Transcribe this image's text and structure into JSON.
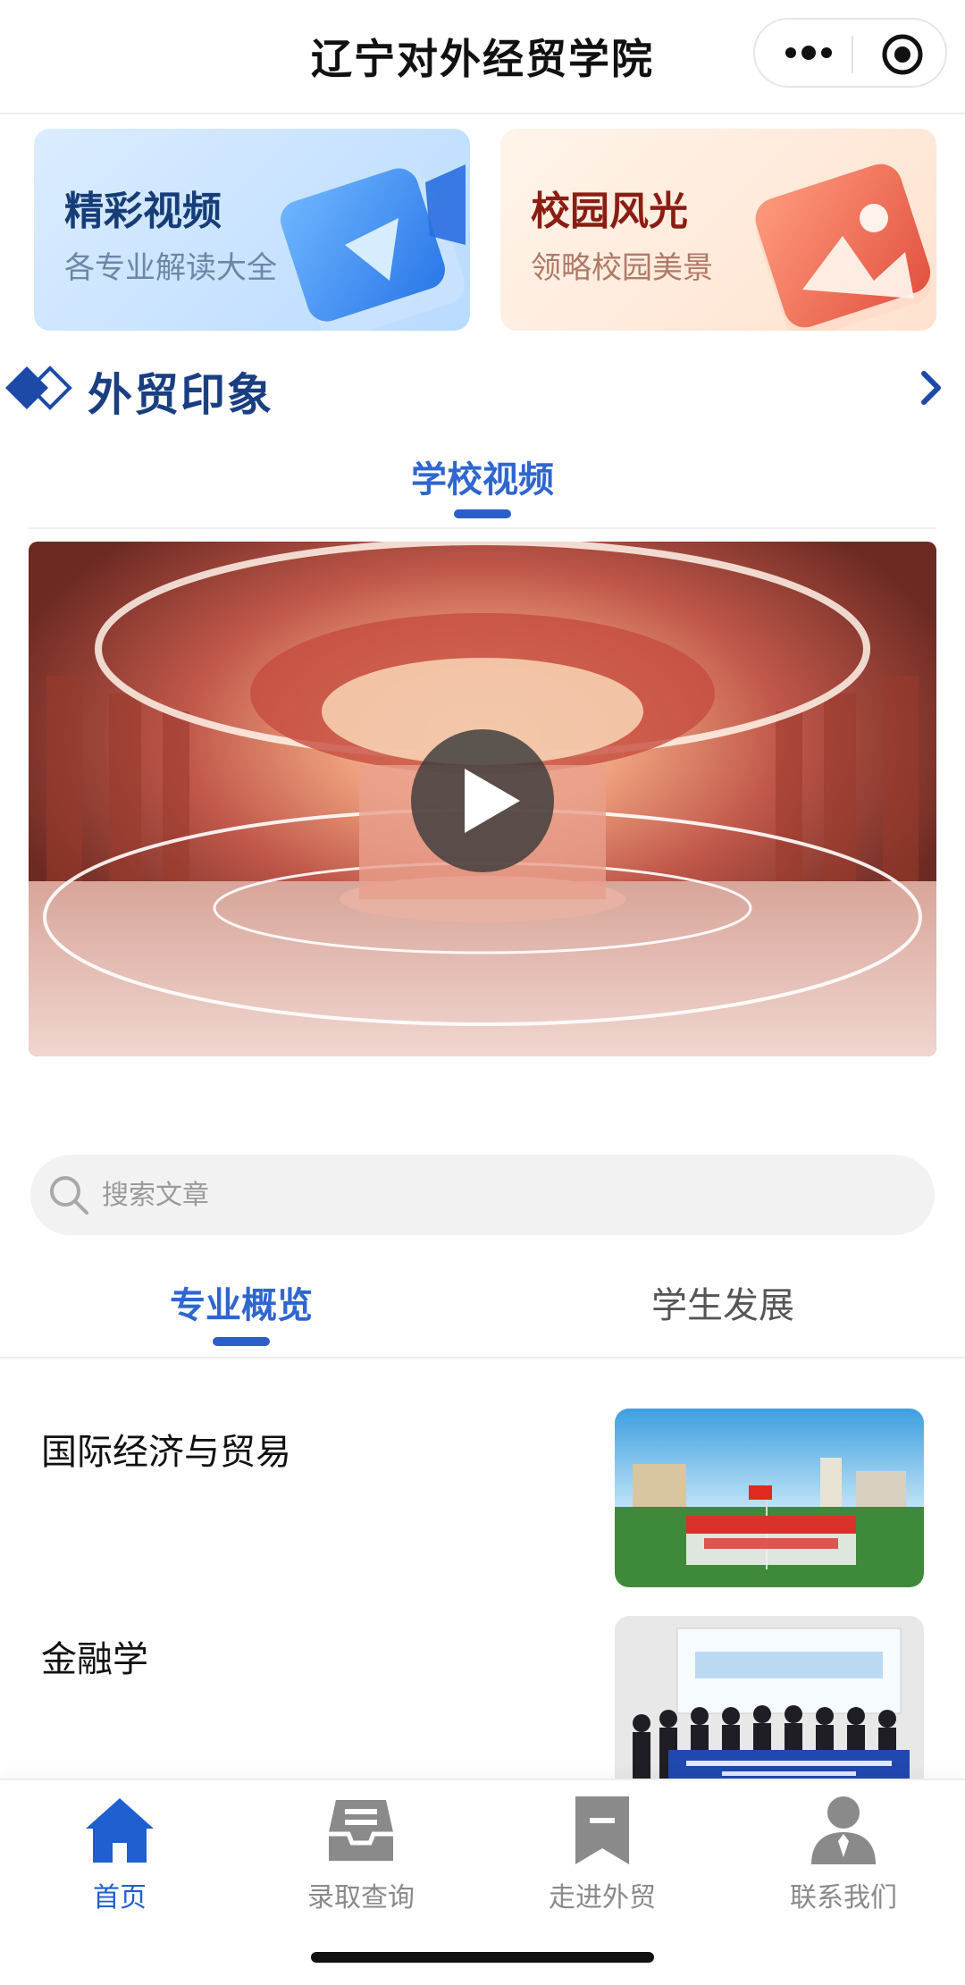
{
  "header": {
    "title": "辽宁对外经贸学院",
    "more_icon": "more-dots-icon",
    "close_icon": "target-close-icon"
  },
  "feature_cards": [
    {
      "title": "精彩视频",
      "subtitle": "各专业解读大全",
      "icon": "video-camera-icon",
      "accent": "#173d78"
    },
    {
      "title": "校园风光",
      "subtitle": "领略校园美景",
      "icon": "picture-icon",
      "accent": "#8b1d12"
    }
  ],
  "section": {
    "title": "外贸印象",
    "accent": "#193f80"
  },
  "video_tab": {
    "label": "学校视频"
  },
  "search": {
    "placeholder": "搜索文章"
  },
  "article_tabs": [
    {
      "label": "专业概览",
      "active": true
    },
    {
      "label": "学生发展",
      "active": false
    }
  ],
  "articles": [
    {
      "title": "国际经济与贸易",
      "thumb": "campus-flag-photo"
    },
    {
      "title": "金融学",
      "thumb": "cfa-class-group-photo"
    }
  ],
  "tabbar": [
    {
      "label": "首页",
      "icon": "home-icon",
      "active": true
    },
    {
      "label": "录取查询",
      "icon": "inbox-tray-icon",
      "active": false
    },
    {
      "label": "走进外贸",
      "icon": "bookmark-icon",
      "active": false
    },
    {
      "label": "联系我们",
      "icon": "user-contact-icon",
      "active": false
    }
  ],
  "colors": {
    "primary": "#2f66d0",
    "tab_active": "#1f5fcf",
    "tab_inactive": "#8a8a8a"
  }
}
